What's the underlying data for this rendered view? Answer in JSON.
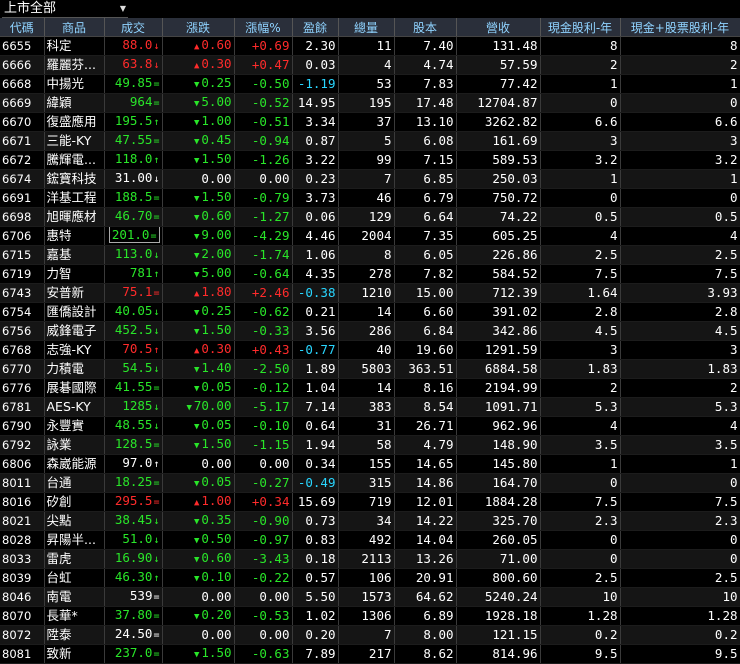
{
  "market_selector": {
    "label": "上市全部",
    "arrow": "▼"
  },
  "columns": [
    "代碼",
    "商品",
    "成交",
    "漲跌",
    "漲幅%",
    "盈餘",
    "總量",
    "股本",
    "營收",
    "現金股利-年",
    "現金+股票股利-年"
  ],
  "rows": [
    {
      "code": "6655",
      "name": "科定",
      "price": "88.0",
      "price_sym": "↓",
      "price_cls": "up",
      "chg": "0.60",
      "chg_dir": "up",
      "pct": "+0.69",
      "pct_cls": "up",
      "eps": "2.30",
      "eps_cls": "flat",
      "vol": "11",
      "capital": "7.40",
      "revenue": "131.48",
      "cash_div": "8",
      "total_div": "8"
    },
    {
      "code": "6666",
      "name": "羅麗芬...",
      "price": "63.8",
      "price_sym": "↓",
      "price_cls": "up",
      "chg": "0.30",
      "chg_dir": "up",
      "pct": "+0.47",
      "pct_cls": "up",
      "eps": "0.03",
      "eps_cls": "flat",
      "vol": "4",
      "capital": "4.74",
      "revenue": "57.59",
      "cash_div": "2",
      "total_div": "2"
    },
    {
      "code": "6668",
      "name": "中揚光",
      "price": "49.85",
      "price_sym": "=",
      "price_cls": "down",
      "chg": "0.25",
      "chg_dir": "down",
      "pct": "-0.50",
      "pct_cls": "down",
      "eps": "-1.19",
      "eps_cls": "cyan",
      "vol": "53",
      "capital": "7.83",
      "revenue": "77.42",
      "cash_div": "1",
      "total_div": "1"
    },
    {
      "code": "6669",
      "name": "緯穎",
      "price": "964",
      "price_sym": "=",
      "price_cls": "down",
      "chg": "5.00",
      "chg_dir": "down",
      "pct": "-0.52",
      "pct_cls": "down",
      "eps": "14.95",
      "eps_cls": "flat",
      "vol": "195",
      "capital": "17.48",
      "revenue": "12704.87",
      "cash_div": "0",
      "total_div": "0"
    },
    {
      "code": "6670",
      "name": "復盛應用",
      "price": "195.5",
      "price_sym": "↑",
      "price_cls": "down",
      "chg": "1.00",
      "chg_dir": "down",
      "pct": "-0.51",
      "pct_cls": "down",
      "eps": "3.34",
      "eps_cls": "flat",
      "vol": "37",
      "capital": "13.10",
      "revenue": "3262.82",
      "cash_div": "6.6",
      "total_div": "6.6"
    },
    {
      "code": "6671",
      "name": "三能-KY",
      "price": "47.55",
      "price_sym": "=",
      "price_cls": "down",
      "chg": "0.45",
      "chg_dir": "down",
      "pct": "-0.94",
      "pct_cls": "down",
      "eps": "0.87",
      "eps_cls": "flat",
      "vol": "5",
      "capital": "6.08",
      "revenue": "161.69",
      "cash_div": "3",
      "total_div": "3"
    },
    {
      "code": "6672",
      "name": "騰輝電...",
      "price": "118.0",
      "price_sym": "↑",
      "price_cls": "down",
      "chg": "1.50",
      "chg_dir": "down",
      "pct": "-1.26",
      "pct_cls": "down",
      "eps": "3.22",
      "eps_cls": "flat",
      "vol": "99",
      "capital": "7.15",
      "revenue": "589.53",
      "cash_div": "3.2",
      "total_div": "3.2"
    },
    {
      "code": "6674",
      "name": "鋐寶科技",
      "price": "31.00",
      "price_sym": "↓",
      "price_cls": "flat",
      "chg": "0.00",
      "chg_dir": "flat",
      "pct": "0.00",
      "pct_cls": "flat",
      "eps": "0.23",
      "eps_cls": "flat",
      "vol": "7",
      "capital": "6.85",
      "revenue": "250.03",
      "cash_div": "1",
      "total_div": "1"
    },
    {
      "code": "6691",
      "name": "洋基工程",
      "price": "188.5",
      "price_sym": "=",
      "price_cls": "down",
      "chg": "1.50",
      "chg_dir": "down",
      "pct": "-0.79",
      "pct_cls": "down",
      "eps": "3.73",
      "eps_cls": "flat",
      "vol": "46",
      "capital": "6.79",
      "revenue": "750.72",
      "cash_div": "0",
      "total_div": "0"
    },
    {
      "code": "6698",
      "name": "旭暉應材",
      "price": "46.70",
      "price_sym": "=",
      "price_cls": "down",
      "chg": "0.60",
      "chg_dir": "down",
      "pct": "-1.27",
      "pct_cls": "down",
      "eps": "0.06",
      "eps_cls": "flat",
      "vol": "129",
      "capital": "6.64",
      "revenue": "74.22",
      "cash_div": "0.5",
      "total_div": "0.5"
    },
    {
      "code": "6706",
      "name": "惠特",
      "price": "201.0",
      "price_sym": "=",
      "price_cls": "down",
      "chg": "9.00",
      "chg_dir": "down",
      "pct": "-4.29",
      "pct_cls": "down",
      "eps": "4.46",
      "eps_cls": "flat",
      "vol": "2004",
      "capital": "7.35",
      "revenue": "605.25",
      "cash_div": "4",
      "total_div": "4",
      "boxed": true
    },
    {
      "code": "6715",
      "name": "嘉基",
      "price": "113.0",
      "price_sym": "↓",
      "price_cls": "down",
      "chg": "2.00",
      "chg_dir": "down",
      "pct": "-1.74",
      "pct_cls": "down",
      "eps": "1.06",
      "eps_cls": "flat",
      "vol": "8",
      "capital": "6.05",
      "revenue": "226.86",
      "cash_div": "2.5",
      "total_div": "2.5"
    },
    {
      "code": "6719",
      "name": "力智",
      "price": "781",
      "price_sym": "↑",
      "price_cls": "down",
      "chg": "5.00",
      "chg_dir": "down",
      "pct": "-0.64",
      "pct_cls": "down",
      "eps": "4.35",
      "eps_cls": "flat",
      "vol": "278",
      "capital": "7.82",
      "revenue": "584.52",
      "cash_div": "7.5",
      "total_div": "7.5"
    },
    {
      "code": "6743",
      "name": "安普新",
      "price": "75.1",
      "price_sym": "=",
      "price_cls": "up",
      "chg": "1.80",
      "chg_dir": "up",
      "pct": "+2.46",
      "pct_cls": "up",
      "eps": "-0.38",
      "eps_cls": "cyan",
      "vol": "1210",
      "capital": "15.00",
      "revenue": "712.39",
      "cash_div": "1.64",
      "total_div": "3.93"
    },
    {
      "code": "6754",
      "name": "匯僑設計",
      "price": "40.05",
      "price_sym": "↓",
      "price_cls": "down",
      "chg": "0.25",
      "chg_dir": "down",
      "pct": "-0.62",
      "pct_cls": "down",
      "eps": "0.21",
      "eps_cls": "flat",
      "vol": "14",
      "capital": "6.60",
      "revenue": "391.02",
      "cash_div": "2.8",
      "total_div": "2.8"
    },
    {
      "code": "6756",
      "name": "威鋒電子",
      "price": "452.5",
      "price_sym": "↓",
      "price_cls": "down",
      "chg": "1.50",
      "chg_dir": "down",
      "pct": "-0.33",
      "pct_cls": "down",
      "eps": "3.56",
      "eps_cls": "flat",
      "vol": "286",
      "capital": "6.84",
      "revenue": "342.86",
      "cash_div": "4.5",
      "total_div": "4.5"
    },
    {
      "code": "6768",
      "name": "志強-KY",
      "price": "70.5",
      "price_sym": "↑",
      "price_cls": "up",
      "chg": "0.30",
      "chg_dir": "up",
      "pct": "+0.43",
      "pct_cls": "up",
      "eps": "-0.77",
      "eps_cls": "cyan",
      "vol": "40",
      "capital": "19.60",
      "revenue": "1291.59",
      "cash_div": "3",
      "total_div": "3"
    },
    {
      "code": "6770",
      "name": "力積電",
      "price": "54.5",
      "price_sym": "↓",
      "price_cls": "down",
      "chg": "1.40",
      "chg_dir": "down",
      "pct": "-2.50",
      "pct_cls": "down",
      "eps": "1.89",
      "eps_cls": "flat",
      "vol": "5803",
      "capital": "363.51",
      "revenue": "6884.58",
      "cash_div": "1.83",
      "total_div": "1.83"
    },
    {
      "code": "6776",
      "name": "展碁國際",
      "price": "41.55",
      "price_sym": "=",
      "price_cls": "down",
      "chg": "0.05",
      "chg_dir": "down",
      "pct": "-0.12",
      "pct_cls": "down",
      "eps": "1.04",
      "eps_cls": "flat",
      "vol": "14",
      "capital": "8.16",
      "revenue": "2194.99",
      "cash_div": "2",
      "total_div": "2"
    },
    {
      "code": "6781",
      "name": "AES-KY",
      "price": "1285",
      "price_sym": "↓",
      "price_cls": "down",
      "chg": "70.00",
      "chg_dir": "down",
      "pct": "-5.17",
      "pct_cls": "down",
      "eps": "7.14",
      "eps_cls": "flat",
      "vol": "383",
      "capital": "8.54",
      "revenue": "1091.71",
      "cash_div": "5.3",
      "total_div": "5.3"
    },
    {
      "code": "6790",
      "name": "永豐實",
      "price": "48.55",
      "price_sym": "↓",
      "price_cls": "down",
      "chg": "0.05",
      "chg_dir": "down",
      "pct": "-0.10",
      "pct_cls": "down",
      "eps": "0.64",
      "eps_cls": "flat",
      "vol": "31",
      "capital": "26.71",
      "revenue": "962.96",
      "cash_div": "4",
      "total_div": "4"
    },
    {
      "code": "6792",
      "name": "詠業",
      "price": "128.5",
      "price_sym": "=",
      "price_cls": "down",
      "chg": "1.50",
      "chg_dir": "down",
      "pct": "-1.15",
      "pct_cls": "down",
      "eps": "1.94",
      "eps_cls": "flat",
      "vol": "58",
      "capital": "4.79",
      "revenue": "148.90",
      "cash_div": "3.5",
      "total_div": "3.5"
    },
    {
      "code": "6806",
      "name": "森崴能源",
      "price": "97.0",
      "price_sym": "↑",
      "price_cls": "flat",
      "chg": "0.00",
      "chg_dir": "flat",
      "pct": "0.00",
      "pct_cls": "flat",
      "eps": "0.34",
      "eps_cls": "flat",
      "vol": "155",
      "capital": "14.65",
      "revenue": "145.80",
      "cash_div": "1",
      "total_div": "1"
    },
    {
      "code": "8011",
      "name": "台通",
      "price": "18.25",
      "price_sym": "=",
      "price_cls": "down",
      "chg": "0.05",
      "chg_dir": "down",
      "pct": "-0.27",
      "pct_cls": "down",
      "eps": "-0.49",
      "eps_cls": "cyan",
      "vol": "315",
      "capital": "14.86",
      "revenue": "164.70",
      "cash_div": "0",
      "total_div": "0"
    },
    {
      "code": "8016",
      "name": "矽創",
      "price": "295.5",
      "price_sym": "=",
      "price_cls": "up",
      "chg": "1.00",
      "chg_dir": "up",
      "pct": "+0.34",
      "pct_cls": "up",
      "eps": "15.69",
      "eps_cls": "flat",
      "vol": "719",
      "capital": "12.01",
      "revenue": "1884.28",
      "cash_div": "7.5",
      "total_div": "7.5"
    },
    {
      "code": "8021",
      "name": "尖點",
      "price": "38.45",
      "price_sym": "↓",
      "price_cls": "down",
      "chg": "0.35",
      "chg_dir": "down",
      "pct": "-0.90",
      "pct_cls": "down",
      "eps": "0.73",
      "eps_cls": "flat",
      "vol": "34",
      "capital": "14.22",
      "revenue": "325.70",
      "cash_div": "2.3",
      "total_div": "2.3"
    },
    {
      "code": "8028",
      "name": "昇陽半...",
      "price": "51.0",
      "price_sym": "↓",
      "price_cls": "down",
      "chg": "0.50",
      "chg_dir": "down",
      "pct": "-0.97",
      "pct_cls": "down",
      "eps": "0.83",
      "eps_cls": "flat",
      "vol": "492",
      "capital": "14.04",
      "revenue": "260.05",
      "cash_div": "0",
      "total_div": "0"
    },
    {
      "code": "8033",
      "name": "雷虎",
      "price": "16.90",
      "price_sym": "↓",
      "price_cls": "down",
      "chg": "0.60",
      "chg_dir": "down",
      "pct": "-3.43",
      "pct_cls": "down",
      "eps": "0.18",
      "eps_cls": "flat",
      "vol": "2113",
      "capital": "13.26",
      "revenue": "71.00",
      "cash_div": "0",
      "total_div": "0"
    },
    {
      "code": "8039",
      "name": "台虹",
      "price": "46.30",
      "price_sym": "↑",
      "price_cls": "down",
      "chg": "0.10",
      "chg_dir": "down",
      "pct": "-0.22",
      "pct_cls": "down",
      "eps": "0.57",
      "eps_cls": "flat",
      "vol": "106",
      "capital": "20.91",
      "revenue": "800.60",
      "cash_div": "2.5",
      "total_div": "2.5"
    },
    {
      "code": "8046",
      "name": "南電",
      "price": "539",
      "price_sym": "=",
      "price_cls": "flat",
      "chg": "0.00",
      "chg_dir": "flat",
      "pct": "0.00",
      "pct_cls": "flat",
      "eps": "5.50",
      "eps_cls": "flat",
      "vol": "1573",
      "capital": "64.62",
      "revenue": "5240.24",
      "cash_div": "10",
      "total_div": "10"
    },
    {
      "code": "8070",
      "name": "長華*",
      "price": "37.80",
      "price_sym": "=",
      "price_cls": "down",
      "chg": "0.20",
      "chg_dir": "down",
      "pct": "-0.53",
      "pct_cls": "down",
      "eps": "1.02",
      "eps_cls": "flat",
      "vol": "1306",
      "capital": "6.89",
      "revenue": "1928.18",
      "cash_div": "1.28",
      "total_div": "1.28"
    },
    {
      "code": "8072",
      "name": "陞泰",
      "price": "24.50",
      "price_sym": "=",
      "price_cls": "flat",
      "chg": "0.00",
      "chg_dir": "flat",
      "pct": "0.00",
      "pct_cls": "flat",
      "eps": "0.20",
      "eps_cls": "flat",
      "vol": "7",
      "capital": "8.00",
      "revenue": "121.15",
      "cash_div": "0.2",
      "total_div": "0.2"
    },
    {
      "code": "8081",
      "name": "致新",
      "price": "237.0",
      "price_sym": "=",
      "price_cls": "down",
      "chg": "1.50",
      "chg_dir": "down",
      "pct": "-0.63",
      "pct_cls": "down",
      "eps": "7.89",
      "eps_cls": "flat",
      "vol": "217",
      "capital": "8.62",
      "revenue": "814.96",
      "cash_div": "9.5",
      "total_div": "9.5"
    }
  ],
  "colors": {
    "up": "#ff2b2b",
    "down": "#29e629",
    "flat": "#ffffff",
    "negative_eps": "#29d6ff",
    "header_bg": "#2a2f3a",
    "header_text": "#8fd3ff"
  },
  "icons": {
    "up": "triangle-up-icon",
    "down": "triangle-down-icon"
  }
}
